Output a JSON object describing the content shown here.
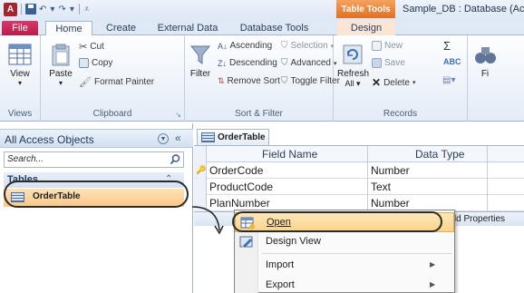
{
  "titlebar": {
    "app_letter": "A",
    "context_tab_header": "Table Tools",
    "doc_title": "Sample_DB : Database (Acc"
  },
  "tabs": {
    "file": "File",
    "home": "Home",
    "create": "Create",
    "external": "External Data",
    "dbtools": "Database Tools",
    "design": "Design"
  },
  "ribbon": {
    "views": {
      "label": "Views",
      "view": "View"
    },
    "clipboard": {
      "label": "Clipboard",
      "paste": "Paste",
      "cut": "Cut",
      "copy": "Copy",
      "format_painter": "Format Painter"
    },
    "sort_filter": {
      "label": "Sort & Filter",
      "filter": "Filter",
      "ascending": "Ascending",
      "descending": "Descending",
      "remove_sort": "Remove Sort",
      "selection": "Selection",
      "advanced": "Advanced",
      "toggle_filter": "Toggle Filter"
    },
    "records": {
      "label": "Records",
      "refresh": "Refresh",
      "refresh_sub": "All",
      "new": "New",
      "save": "Save",
      "delete": "Delete"
    },
    "find": {
      "label_partial": "Fi"
    }
  },
  "nav": {
    "title": "All Access Objects",
    "search_placeholder": "Search...",
    "group": "Tables",
    "items": [
      {
        "label": "OrderTable"
      }
    ]
  },
  "object": {
    "tab_label": "OrderTable",
    "columns": [
      "Field Name",
      "Data Type"
    ],
    "rows": [
      {
        "field": "OrderCode",
        "type": "Number",
        "key": true
      },
      {
        "field": "ProductCode",
        "type": "Text",
        "key": false
      },
      {
        "field": "PlanNumber",
        "type": "Number",
        "key": false
      }
    ],
    "field_properties": "Field Properties"
  },
  "context_menu": {
    "items": [
      {
        "label": "Open",
        "icon": "open-table-icon",
        "active": true,
        "submenu": false
      },
      {
        "label": "Design View",
        "icon": "design-view-icon",
        "active": false,
        "submenu": false
      },
      {
        "label": "Import",
        "icon": "",
        "active": false,
        "submenu": true
      },
      {
        "label": "Export",
        "icon": "",
        "active": false,
        "submenu": true
      }
    ]
  }
}
